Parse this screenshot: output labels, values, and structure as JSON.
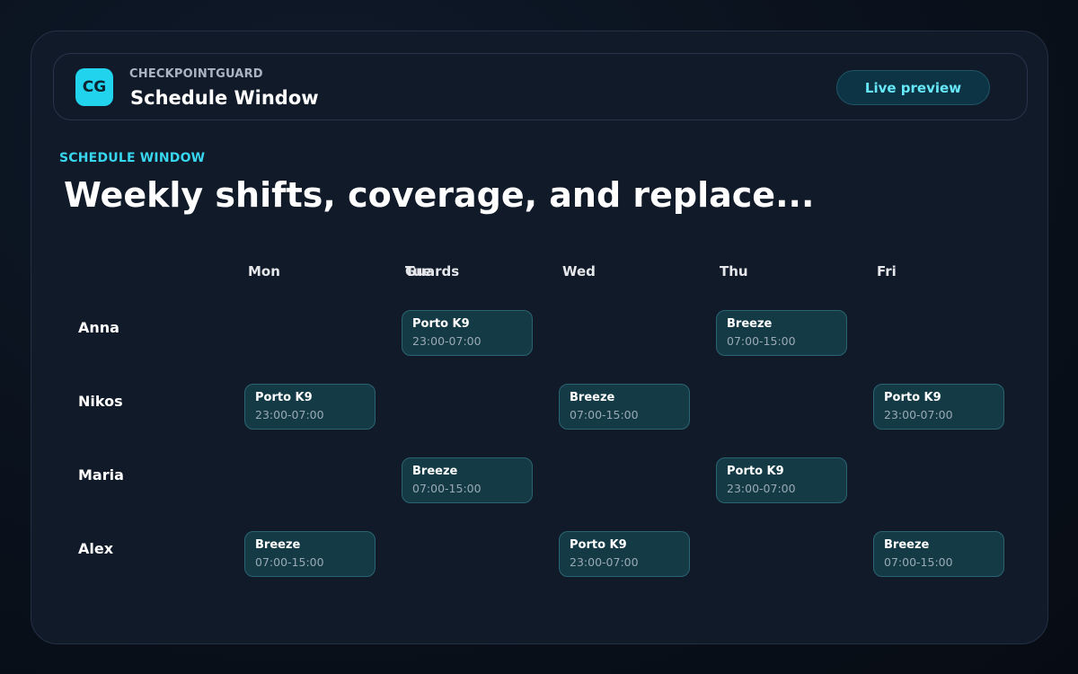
{
  "header": {
    "logo_text": "CG",
    "brand": "CHECKPOINTGUARD",
    "title": "Schedule Window",
    "live_preview_label": "Live preview"
  },
  "section": {
    "eyebrow": "SCHEDULE WINDOW",
    "headline": "Weekly shifts, coverage, and replace..."
  },
  "grid": {
    "guards_header": "Guards",
    "days": [
      "Mon",
      "Tue",
      "Wed",
      "Thu",
      "Fri"
    ],
    "rows": [
      {
        "name": "Anna",
        "shifts": {
          "Tue": {
            "site": "Porto K9",
            "time": "23:00-07:00"
          },
          "Thu": {
            "site": "Breeze",
            "time": "07:00-15:00"
          }
        }
      },
      {
        "name": "Nikos",
        "shifts": {
          "Mon": {
            "site": "Porto K9",
            "time": "23:00-07:00"
          },
          "Wed": {
            "site": "Breeze",
            "time": "07:00-15:00"
          },
          "Fri": {
            "site": "Porto K9",
            "time": "23:00-07:00"
          }
        }
      },
      {
        "name": "Maria",
        "shifts": {
          "Tue": {
            "site": "Breeze",
            "time": "07:00-15:00"
          },
          "Thu": {
            "site": "Porto K9",
            "time": "23:00-07:00"
          }
        }
      },
      {
        "name": "Alex",
        "shifts": {
          "Mon": {
            "site": "Breeze",
            "time": "07:00-15:00"
          },
          "Wed": {
            "site": "Porto K9",
            "time": "23:00-07:00"
          },
          "Fri": {
            "site": "Breeze",
            "time": "07:00-15:00"
          }
        }
      }
    ]
  },
  "colors": {
    "accent": "#22d3ee",
    "shift_bg": "#143a46",
    "card_bg": "#111a29"
  }
}
